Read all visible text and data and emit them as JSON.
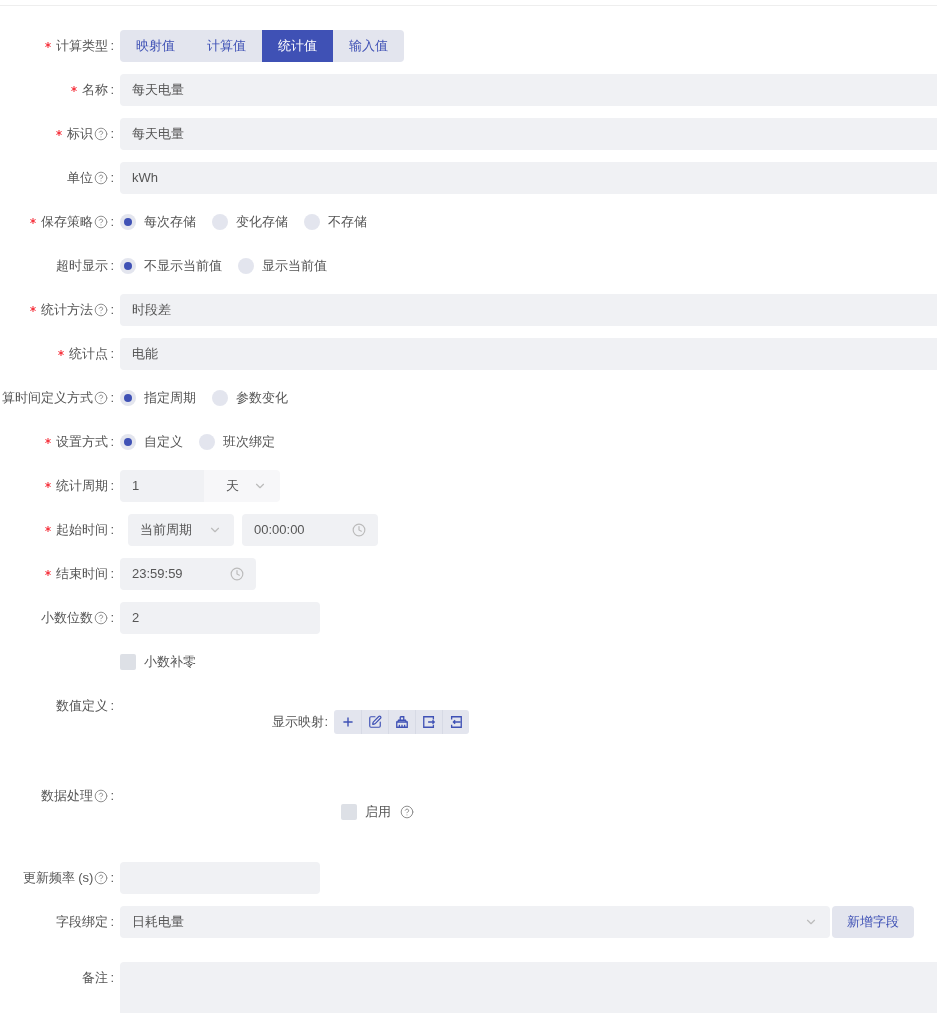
{
  "form": {
    "rows": [
      {
        "kind": "segmented",
        "label": "计算类型",
        "colon": ":",
        "required": true,
        "help": false,
        "options": [
          {
            "label": "映射值",
            "selected": false
          },
          {
            "label": "计算值",
            "selected": false
          },
          {
            "label": "统计值",
            "selected": true
          },
          {
            "label": "输入值",
            "selected": false
          }
        ]
      },
      {
        "kind": "input",
        "label": "名称",
        "colon": ":",
        "required": true,
        "help": false,
        "value": "每天电量"
      },
      {
        "kind": "input",
        "label": "标识",
        "colon": ":",
        "required": true,
        "help": true,
        "value": "每天电量"
      },
      {
        "kind": "input",
        "label": "单位",
        "colon": ":",
        "required": false,
        "help": true,
        "value": "kWh"
      },
      {
        "kind": "radio",
        "label": "保存策略",
        "colon": ":",
        "required": true,
        "help": true,
        "options": [
          {
            "label": "每次存储",
            "selected": true
          },
          {
            "label": "变化存储",
            "selected": false
          },
          {
            "label": "不存储",
            "selected": false
          }
        ]
      },
      {
        "kind": "radio",
        "label": "超时显示",
        "colon": ":",
        "required": false,
        "help": false,
        "options": [
          {
            "label": "不显示当前值",
            "selected": true
          },
          {
            "label": "显示当前值",
            "selected": false
          }
        ]
      },
      {
        "kind": "input",
        "label": "统计方法",
        "colon": ":",
        "required": true,
        "help": true,
        "value": "时段差"
      },
      {
        "kind": "input",
        "label": "统计点",
        "colon": ":",
        "required": true,
        "help": false,
        "value": "电能"
      },
      {
        "kind": "radio",
        "label": "算时间定义方式",
        "colon": ":",
        "required": false,
        "help": true,
        "options": [
          {
            "label": "指定周期",
            "selected": true
          },
          {
            "label": "参数变化",
            "selected": false
          }
        ]
      },
      {
        "kind": "radio",
        "label": "设置方式",
        "colon": ":",
        "required": true,
        "help": false,
        "options": [
          {
            "label": "自定义",
            "selected": true
          },
          {
            "label": "班次绑定",
            "selected": false
          }
        ]
      },
      {
        "kind": "period",
        "label": "统计周期",
        "colon": ":",
        "required": true,
        "help": false,
        "value": "1",
        "unit": "天"
      },
      {
        "kind": "start_time",
        "label": "起始时间",
        "colon": ":",
        "required": true,
        "help": false,
        "select": "当前周期",
        "time": "00:00:00"
      },
      {
        "kind": "time",
        "label": "结束时间",
        "colon": ":",
        "required": true,
        "help": false,
        "time": "23:59:59"
      },
      {
        "kind": "short_input",
        "label": "小数位数",
        "colon": ":",
        "required": false,
        "help": true,
        "value": "2"
      },
      {
        "kind": "checkbox",
        "text": "小数补零",
        "checked": false
      },
      {
        "kind": "mapping",
        "label": "数值定义",
        "colon": ":",
        "required": false,
        "help": false,
        "sublabel": "显示映射:"
      },
      {
        "kind": "enable",
        "label": "数据处理",
        "colon": ":",
        "required": false,
        "help": true,
        "text": "启用",
        "checked": false
      },
      {
        "kind": "short_input",
        "label": "更新频率 (s)",
        "colon": ":",
        "required": false,
        "help": true
      },
      {
        "kind": "select_button",
        "label": "字段绑定",
        "colon": ":",
        "required": false,
        "help": false,
        "value": "日耗电量",
        "button": "新增字段"
      },
      {
        "kind": "textarea",
        "label": "备注",
        "colon": ":",
        "required": false,
        "help": false
      }
    ]
  }
}
